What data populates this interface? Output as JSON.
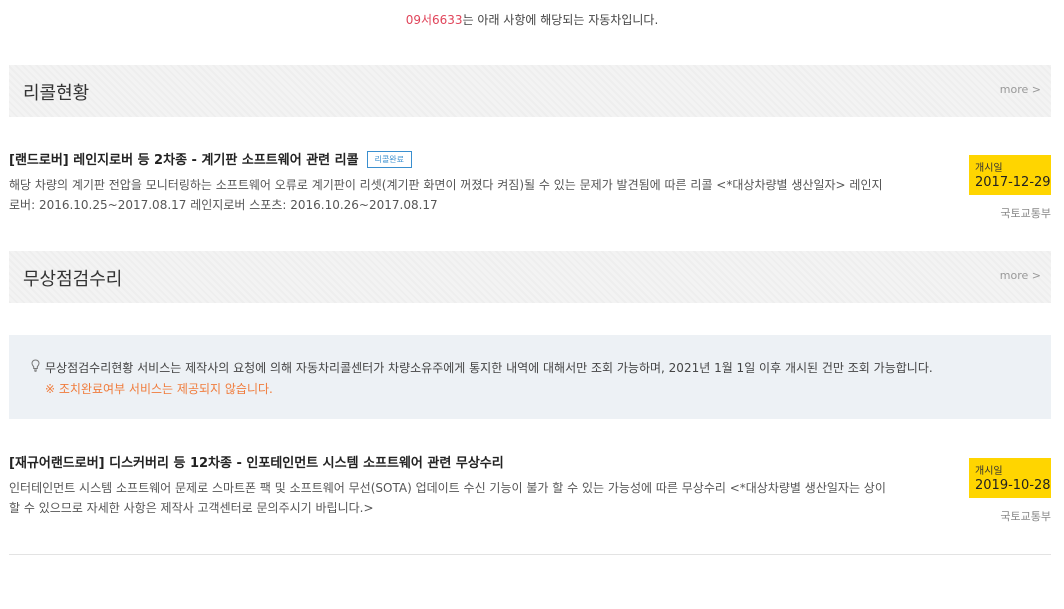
{
  "intro": {
    "plate": "09서6633",
    "text": "는 아래 사항에 해당되는 자동차입니다."
  },
  "recall": {
    "section_title": "리콜현황",
    "more_label": "more >",
    "items": [
      {
        "title": "[랜드로버] 레인지로버 등 2차종 - 계기판 소프트웨어 관련 리콜",
        "badge": "리콜완료",
        "desc": "해당 차량의 계기판 전압을 모니터링하는 소프트웨어 오류로 계기판이 리셋(계기판 화면이 꺼졌다 켜짐)될 수 있는 문제가 발견됨에 따른 리콜 <*대상차량별 생산일자> 레인지로버: 2016.10.25~2017.08.17 레인지로버 스포츠: 2016.10.26~2017.08.17",
        "date_label": "개시일",
        "date": "2017-12-29",
        "agency": "국토교통부"
      }
    ]
  },
  "free_repair": {
    "section_title": "무상점검수리",
    "more_label": "more >",
    "notice_line1": "무상점검수리현황 서비스는 제작사의 요청에 의해 자동차리콜센터가 차량소유주에게 통지한 내역에 대해서만 조회 가능하며, 2021년 1월 1일 이후 개시된 건만 조회 가능합니다.",
    "notice_line2": "※ 조치완료여부 서비스는 제공되지 않습니다.",
    "notice_icon": "lightbulb-icon",
    "items": [
      {
        "title": "[재규어랜드로버] 디스커버리 등 12차종 - 인포테인먼트 시스템 소프트웨어 관련 무상수리",
        "desc": "인터테인먼트 시스템 소프트웨어 문제로 스마트폰 팩 및 소프트웨어 무선(SOTA) 업데이트 수신 기능이 불가 할 수 있는 가능성에 따른 무상수리 <*대상차량별 생산일자는 상이할 수 있으므로 자세한 사항은 제작사 고객센터로 문의주시기 바립니다.>",
        "date_label": "개시일",
        "date": "2019-10-28",
        "agency": "국토교통부"
      }
    ]
  },
  "colors": {
    "plate": "#e0445a",
    "badge": "#3a8fcf",
    "date_box": "#ffd500",
    "notice_warn": "#f07c3c",
    "notice_bg": "#edf1f5"
  }
}
